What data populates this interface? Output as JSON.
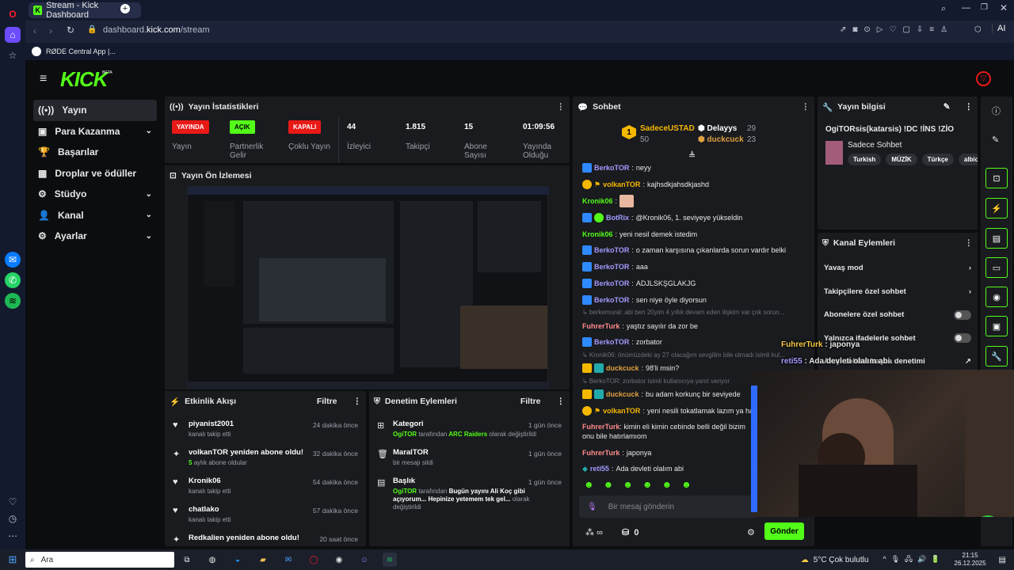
{
  "browser": {
    "tab_title": "Stream - Kick Dashboard",
    "url_prefix": "dashboard.",
    "url_domain": "kick.com",
    "url_path": "/stream",
    "ai_label": "AI",
    "bookmark": "RØDE Central App |..."
  },
  "logo": "KICK",
  "logo_beta": "BETA",
  "nav": [
    {
      "label": "Yayın",
      "icon": "broadcast-icon"
    },
    {
      "label": "Para Kazanma",
      "icon": "wallet-icon",
      "chev": "⌄"
    },
    {
      "label": "Başarılar",
      "icon": "trophy-icon"
    },
    {
      "label": "Droplar ve ödüller",
      "icon": "gift-icon"
    },
    {
      "label": "Stüdyo",
      "icon": "gear-icon",
      "chev": "⌄"
    },
    {
      "label": "Kanal",
      "icon": "user-icon",
      "chev": "⌄"
    },
    {
      "label": "Ayarlar",
      "icon": "settings-icon",
      "chev": "⌄"
    }
  ],
  "stats": {
    "title": "Yayın İstatistikleri",
    "items": [
      {
        "badge": "YAYINDA",
        "badge_color": "#e91916",
        "label": "Yayın"
      },
      {
        "badge": "AÇIK",
        "badge_color": "#53fc18",
        "label": "Partnerlik Gelir"
      },
      {
        "badge": "KAPALI",
        "badge_color": "#e91916",
        "label": "Çoklu Yayın"
      },
      {
        "value": "44",
        "label": "İzleyici"
      },
      {
        "value": "1.815",
        "label": "Takipçi"
      },
      {
        "value": "15",
        "label": "Abone Sayısı"
      },
      {
        "value": "01:09:56",
        "label": "Yayında Olduğu"
      }
    ]
  },
  "preview": {
    "title": "Yayın Ön İzlemesi"
  },
  "activity": {
    "title": "Etkinlik Akışı",
    "filter": "Filtre",
    "items": [
      {
        "name": "piyanist2001",
        "sub": "kanalı takip etti",
        "time": "24 dakika önce",
        "icon": "heart-icon",
        "glyph": "♥"
      },
      {
        "name": "volkanTOR yeniden abone oldu!",
        "sub_count": "5",
        "sub": "aylık abone oldular",
        "time": "32 dakika önce",
        "icon": "sparkle-icon",
        "glyph": "✦"
      },
      {
        "name": "Kronik06",
        "sub": "kanalı takip etti",
        "time": "54 dakika önce",
        "icon": "heart-icon",
        "glyph": "♥"
      },
      {
        "name": "chatlako",
        "sub": "kanalı takip etti",
        "time": "57 dakika önce",
        "icon": "heart-icon",
        "glyph": "♥"
      },
      {
        "name": "Redkalien yeniden abone oldu!",
        "sub": "",
        "time": "20 saat önce",
        "icon": "sparkle-icon",
        "glyph": "✦"
      }
    ]
  },
  "moderation": {
    "title": "Denetim Eylemleri",
    "filter": "Filtre",
    "items": [
      {
        "title": "Kategori",
        "user": "OgiTOR",
        "mid": "tarafından",
        "hl": "ARC Raiders",
        "tail": "olarak değiştirildi",
        "time": "1 gün önce",
        "glyph": "⊞"
      },
      {
        "title": "MaralTOR",
        "user": "",
        "mid": "",
        "hl": "",
        "tail": "bir mesajı sildi",
        "time": "1 gün önce",
        "glyph": "🗑"
      },
      {
        "title": "Başlık",
        "user": "OgiTOR",
        "mid": "tarafından",
        "hl": "Bugün yayını Ali Koç gibi açıyorum... Hepinize yetemem tek gel...",
        "tail": "olarak değiştirildi",
        "time": "1 gün önce",
        "glyph": "▤"
      }
    ]
  },
  "chat": {
    "title": "Sohbet",
    "leaders": [
      {
        "rank": "1",
        "name": "SadeceUSTAD",
        "count": "50",
        "color": "#f5b800"
      },
      {
        "name": "Delayys",
        "count": "29",
        "color": "#d6d6d6"
      },
      {
        "name": "duckcuck",
        "count": "23",
        "color": "#e0a040"
      }
    ],
    "messages": [
      {
        "user": "BerkoTOR",
        "color": "#a29bfe",
        "text": "neyy",
        "badge": "#2f89ff"
      },
      {
        "user": "volkanTOR",
        "color": "#f5b800",
        "text": "kajhsdkjahsdkjashd",
        "badge": "#f5b800"
      },
      {
        "user": "Kronik06",
        "color": "#53fc18",
        "text": "",
        "emote": true
      },
      {
        "user": "BotRix",
        "color": "#a29bfe",
        "text": "@Kronik06, 1. seviyeye yükseldin",
        "badge": "#2f89ff"
      },
      {
        "user": "Kronik06",
        "color": "#53fc18",
        "text": "yeni nesil demek istedim"
      },
      {
        "user": "BerkoTOR",
        "color": "#a29bfe",
        "text": "o zaman karşısına çıkanlarda sorun vardır belki",
        "badge": "#2f89ff"
      },
      {
        "user": "BerkoTOR",
        "color": "#a29bfe",
        "text": "aaa",
        "badge": "#2f89ff"
      },
      {
        "user": "BerkoTOR",
        "color": "#a29bfe",
        "text": "ADJLSKŞGLAKJG",
        "badge": "#2f89ff"
      },
      {
        "user": "BerkoTOR",
        "color": "#a29bfe",
        "text": "sen niye öyle diyorsun",
        "badge": "#2f89ff"
      },
      {
        "reply": "↳ berkemural: abi ben 20yim 4 yıllık devam eden ilişkim var çok sorun..."
      },
      {
        "user": "FuhrerTurk",
        "color": "#ff8a8a",
        "text": "yaştız sayılır da zor be"
      },
      {
        "user": "BerkoTOR",
        "color": "#a29bfe",
        "text": "zorbator",
        "badge": "#2f89ff"
      },
      {
        "reply": "↳ Kronik06: önümüzdeki ay 27 olacağım sevgilim bile olmadı isimli kul..."
      },
      {
        "user": "duckcuck",
        "color": "#e0a040",
        "text": "98'li msin?",
        "badge": "#f5b800"
      },
      {
        "reply": "↳ BerkoTOR: zorbator isimli kullanıcıya yanıt veriyor"
      },
      {
        "user": "duckcuck",
        "color": "#e0a040",
        "text": "bu adam korkunç bir seviyede",
        "badge": "#f5b800"
      },
      {
        "user": "volkanTOR",
        "color": "#f5b800",
        "text": "yeni nesili tokatlamak lazım ya ha",
        "badge": "#f5b800"
      },
      {
        "user": "FuhrerTurk",
        "color": "#ff8a8a",
        "text": "kimin eli kimin cebinde belli değil bizim onu bile hatırlamıom"
      },
      {
        "user": "FuhrerTurk",
        "color": "#ff8a8a",
        "text": "japonya"
      },
      {
        "user": "reti55",
        "color": "#a29bfe",
        "text": "Ada devleti olalım abi"
      }
    ],
    "placeholder": "Bir mesaj gönderin",
    "infinity": "∞",
    "zero": "0",
    "send": "Gönder"
  },
  "info": {
    "title": "Yayın bilgisi",
    "stream_title": "OgiTORsis(katarsis) !DC !İNS !ZİO",
    "category": "Sadece Sohbet",
    "tags": [
      "Turkish",
      "MÜZİK",
      "Türkçe",
      "albio"
    ]
  },
  "channel_actions": {
    "title": "Kanal Eylemleri",
    "items": [
      {
        "label": "Yavaş mod",
        "type": "arrow"
      },
      {
        "label": "Takipçilere özel sohbet",
        "type": "arrow"
      },
      {
        "label": "Abonelere özel sohbet",
        "type": "toggle"
      },
      {
        "label": "Yalnızca ifadelerle sohbet",
        "type": "toggle"
      },
      {
        "label": "Akışı sohbet başka denetimi",
        "type": "link"
      }
    ]
  },
  "overlay": {
    "line1_user": "FuhrerTurk",
    "line1_text": "japonya",
    "line2_user": "reti55",
    "line2_text": "Ada devleti olalım abi"
  },
  "taskbar": {
    "search": "Ara",
    "weather": "5°C  Çok bulutlu",
    "time": "21:15",
    "date": "26.12.2025"
  }
}
